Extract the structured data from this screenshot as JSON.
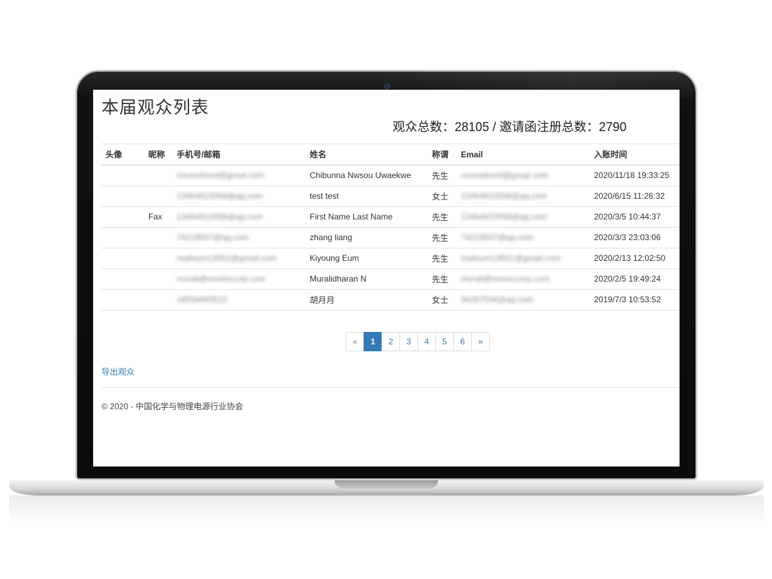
{
  "page": {
    "title": "本届观众列表",
    "summary": "观众总数：28105 / 邀请函注册总数：2790"
  },
  "table": {
    "headers": [
      "头像",
      "昵称",
      "手机号/邮箱",
      "姓名",
      "称谓",
      "Email",
      "入账时间"
    ],
    "rows": [
      {
        "avatar": "",
        "nickname": "",
        "contact": "cnuewtsest@gmail.com",
        "name": "Chibunna Nwsou Uwaekwe",
        "title": "先生",
        "email": "cnuewtsest@gmail.com",
        "time": "2020/11/18 19:33:25"
      },
      {
        "avatar": "",
        "nickname": "",
        "contact": "13454910058@qq.com",
        "name": "test test",
        "title": "女士",
        "email": "13454910058@qq.com",
        "time": "2020/6/15 11:26:32"
      },
      {
        "avatar": "",
        "nickname": "Fax",
        "contact": "13454910058@qq.com",
        "name": "First Name Last Name",
        "title": "先生",
        "email": "13454910058@qq.com",
        "time": "2020/3/5 10:44:37"
      },
      {
        "avatar": "",
        "nickname": "",
        "contact": "74219507@qq.com",
        "name": "zhang liang",
        "title": "先生",
        "email": "74219507@qq.com",
        "time": "2020/3/3 23:03:06"
      },
      {
        "avatar": "",
        "nickname": "",
        "contact": "mailsum13551@gmail.com",
        "name": "Kiyoung Eum",
        "title": "先生",
        "email": "mailsum13551@gmail.com",
        "time": "2020/2/13 12:02:50"
      },
      {
        "avatar": "",
        "nickname": "",
        "contact": "murali@ensinccorp.com",
        "name": "Muralidharan N",
        "title": "先生",
        "email": "murali@ensinccorp.com",
        "time": "2020/2/5 19:49:24"
      },
      {
        "avatar": "",
        "nickname": "",
        "contact": "18559493522",
        "name": "胡月月",
        "title": "女士",
        "email": "94267534@qq.com",
        "time": "2019/7/3 10:53:52"
      }
    ]
  },
  "pagination": {
    "prev": "«",
    "pages": [
      "1",
      "2",
      "3",
      "4",
      "5",
      "6"
    ],
    "next": "»",
    "active": "1"
  },
  "actions": {
    "export_label": "导出观众"
  },
  "footer": {
    "text": "© 2020 - 中国化学与物理电源行业协会"
  },
  "colors": {
    "link": "#337ab7",
    "active_page_bg": "#337ab7"
  }
}
